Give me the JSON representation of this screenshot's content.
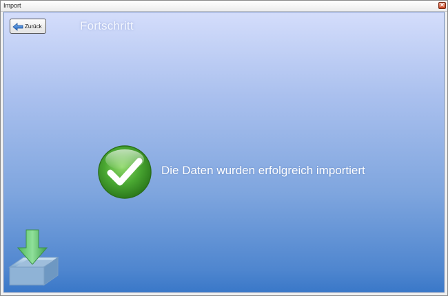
{
  "window": {
    "title": "Import",
    "close_glyph": "✕"
  },
  "toolbar": {
    "back_label": "Zurück",
    "back_icon": "back-arrow-icon"
  },
  "main": {
    "heading": "Fortschritt",
    "status_icon": "checkmark-icon",
    "status_message": "Die Daten wurden erfolgreich importiert",
    "decor_icon": "import-tray-icon"
  },
  "colors": {
    "background_top": "#d4ddfb",
    "background_bottom": "#3a78c8",
    "success_green": "#3c9a2a",
    "arrow_blue": "#2f7fd6",
    "import_arrow_green": "#5cc06a"
  }
}
